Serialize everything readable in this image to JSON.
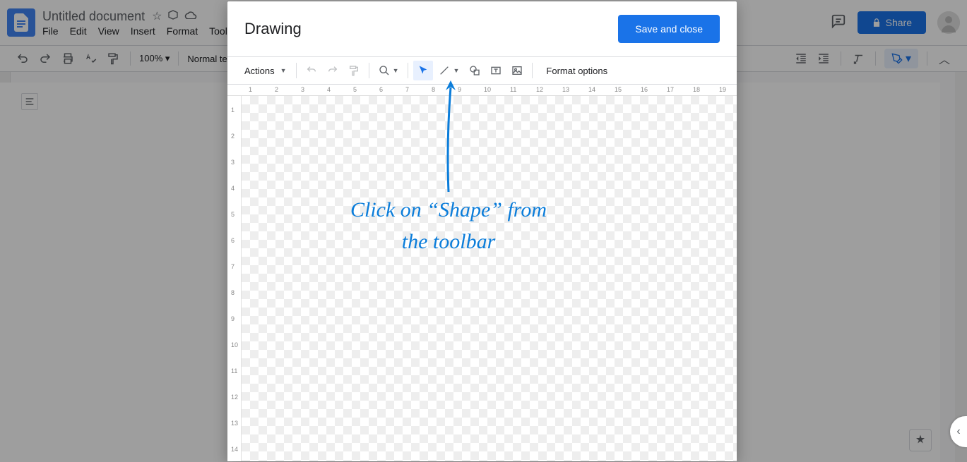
{
  "docs": {
    "title": "Untitled document",
    "menu": {
      "file": "File",
      "edit": "Edit",
      "view": "View",
      "insert": "Insert",
      "format": "Format",
      "tools": "Tools"
    },
    "zoom": "100%",
    "style": "Normal text",
    "share": "Share"
  },
  "dialog": {
    "title": "Drawing",
    "save": "Save and close",
    "actions": "Actions",
    "format_options": "Format options"
  },
  "ruler_h": [
    "1",
    "2",
    "3",
    "4",
    "5",
    "6",
    "7",
    "8",
    "9",
    "10",
    "11",
    "12",
    "13",
    "14",
    "15",
    "16",
    "17",
    "18",
    "19"
  ],
  "ruler_v": [
    "1",
    "2",
    "3",
    "4",
    "5",
    "6",
    "7",
    "8",
    "9",
    "10",
    "11",
    "12",
    "13",
    "14"
  ],
  "annotation": {
    "line1": "Click on “Shape” from",
    "line2": "the toolbar"
  }
}
